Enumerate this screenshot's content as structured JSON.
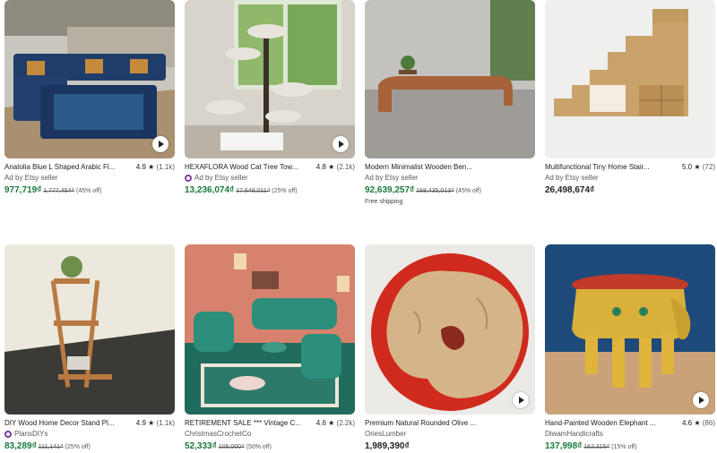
{
  "listings": [
    {
      "title": "Anatolia Blue L Shaped Arabic Fl...",
      "rating": "4.9",
      "reviews": "(1.1k)",
      "seller": "Ad by Etsy seller",
      "price": "977,719₫",
      "original": "1,777,454₫",
      "discount": "(45% off)",
      "shipping": "",
      "video": true,
      "star_seller": false
    },
    {
      "title": "HEXAFLORA Wood Cat Tree Tow...",
      "rating": "4.8",
      "reviews": "(2.1k)",
      "seller": "Ad by Etsy seller",
      "price": "13,236,074₫",
      "original": "17,648,011₫",
      "discount": "(25% off)",
      "shipping": "",
      "video": true,
      "star_seller": true
    },
    {
      "title": "Modern Minimalist Wooden Ben...",
      "rating": "",
      "reviews": "",
      "seller": "Ad by Etsy seller",
      "price": "92,639,257₫",
      "original": "168,435,013₫",
      "discount": "(45% off)",
      "shipping": "Free shipping",
      "video": false,
      "star_seller": false
    },
    {
      "title": "Multifunctional Tiny Home Stair...",
      "rating": "5.0",
      "reviews": "(72)",
      "seller": "Ad by Etsy seller",
      "price": "26,498,674₫",
      "original": "",
      "discount": "",
      "shipping": "",
      "video": false,
      "star_seller": false
    },
    {
      "title": "DIY Wood Home Decor Stand Pl...",
      "rating": "4.9",
      "reviews": "(1.1k)",
      "seller": "PlansDIYs",
      "price": "83,289₫",
      "original": "111,141₫",
      "discount": "(25% off)",
      "shipping": "",
      "video": false,
      "star_seller": true
    },
    {
      "title": "RETIREMENT SALE *** Vintage C...",
      "rating": "4.6",
      "reviews": "(2.2k)",
      "seller": "ChristmasCrochetCo",
      "price": "52,333₫",
      "original": "105,000₫",
      "discount": "(50% off)",
      "shipping": "",
      "video": false,
      "star_seller": false
    },
    {
      "title": "Premium Natural Rounded Olive ...",
      "rating": "",
      "reviews": "",
      "seller": "OriesLumber",
      "price": "1,989,390₫",
      "original": "",
      "discount": "",
      "shipping": "",
      "video": true,
      "star_seller": false
    },
    {
      "title": "Hand-Painted Wooden Elephant ...",
      "rating": "4.6",
      "reviews": "(86)",
      "seller": "DiwamHandicrafts",
      "price": "137,998₫",
      "original": "162,315₫",
      "discount": "(15% off)",
      "shipping": "",
      "video": true,
      "star_seller": false
    }
  ],
  "colors": {
    "sale_price": "#1a7a3c",
    "star_seller_badge": "#7f3e98"
  },
  "icons": {
    "rating": "star-icon",
    "video": "play-icon",
    "badge": "star-seller-icon"
  }
}
